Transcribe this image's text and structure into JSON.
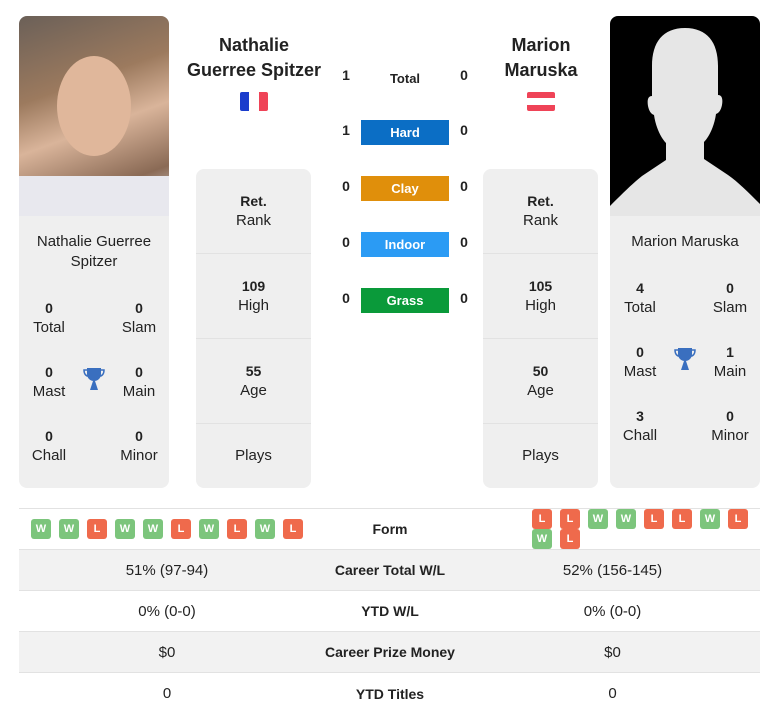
{
  "player1": {
    "name_line1": "Nathalie",
    "name_line2": "Guerree Spitzer",
    "card_name": "Nathalie Guerree Spitzer",
    "flag": "france-flag",
    "titles": {
      "total": "0",
      "slam": "0",
      "mast": "0",
      "main": "0",
      "chall": "0",
      "minor": "0"
    },
    "rank": {
      "value": "Ret.",
      "label": "Rank"
    },
    "high": {
      "value": "109",
      "label": "High"
    },
    "age": {
      "value": "55",
      "label": "Age"
    },
    "plays": {
      "label": "Plays"
    },
    "form": [
      "W",
      "W",
      "L",
      "W",
      "W",
      "L",
      "W",
      "L",
      "W",
      "L"
    ],
    "career_wl": "51% (97-94)",
    "ytd_wl": "0% (0-0)",
    "prize": "$0",
    "ytd_titles": "0"
  },
  "player2": {
    "name_line1": "Marion",
    "name_line2": "Maruska",
    "card_name": "Marion Maruska",
    "flag": "austria-flag",
    "titles": {
      "total": "4",
      "slam": "0",
      "mast": "0",
      "main": "1",
      "chall": "3",
      "minor": "0"
    },
    "rank": {
      "value": "Ret.",
      "label": "Rank"
    },
    "high": {
      "value": "105",
      "label": "High"
    },
    "age": {
      "value": "50",
      "label": "Age"
    },
    "plays": {
      "label": "Plays"
    },
    "form": [
      "L",
      "L",
      "W",
      "W",
      "L",
      "L",
      "W",
      "L",
      "W",
      "L"
    ],
    "career_wl": "52% (156-145)",
    "ytd_wl": "0% (0-0)",
    "prize": "$0",
    "ytd_titles": "0"
  },
  "labels": {
    "total": "Total",
    "slam": "Slam",
    "mast": "Mast",
    "main": "Main",
    "chall": "Chall",
    "minor": "Minor"
  },
  "h2h": [
    {
      "label": "Total",
      "p1": "1",
      "p2": "0",
      "color": null
    },
    {
      "label": "Hard",
      "p1": "1",
      "p2": "0",
      "color": "#0b6ec5"
    },
    {
      "label": "Clay",
      "p1": "0",
      "p2": "0",
      "color": "#e08f0b"
    },
    {
      "label": "Indoor",
      "p1": "0",
      "p2": "0",
      "color": "#2b9bf4"
    },
    {
      "label": "Grass",
      "p1": "0",
      "p2": "0",
      "color": "#0a9a3a"
    }
  ],
  "compare": {
    "form": "Form",
    "career_wl": "Career Total W/L",
    "ytd_wl": "YTD W/L",
    "prize": "Career Prize Money",
    "ytd_titles": "YTD Titles"
  },
  "colors": {
    "win": "#7cc57c",
    "loss": "#ef6a4c",
    "trophy": "#3a6fbf"
  }
}
